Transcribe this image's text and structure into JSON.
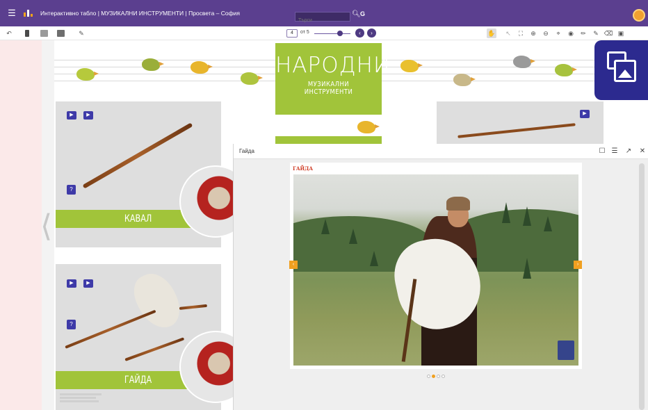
{
  "topbar": {
    "menu_icon": "menu-icon",
    "title": "Интерактивно табло | МУЗИКАЛНИ ИНСТРУМЕНТИ | Просвета – София",
    "search_placeholder": "Търси",
    "g_label": "G",
    "brand_color": "#5b3f8f"
  },
  "toolbar": {
    "page_current": "4",
    "page_of": "от 5"
  },
  "poster": {
    "title_line1": "НАРОДНИ",
    "title_line2": "МУЗИКАЛНИ ИНСТРУМЕНТИ",
    "card1_label": "КАВАЛ",
    "card2_label": "ГАЙДА",
    "accent_green": "#a1c43a"
  },
  "modal": {
    "title": "Гайда",
    "frame_label": "ГАЙДА",
    "slide_count": 4,
    "active_slide": 2
  }
}
